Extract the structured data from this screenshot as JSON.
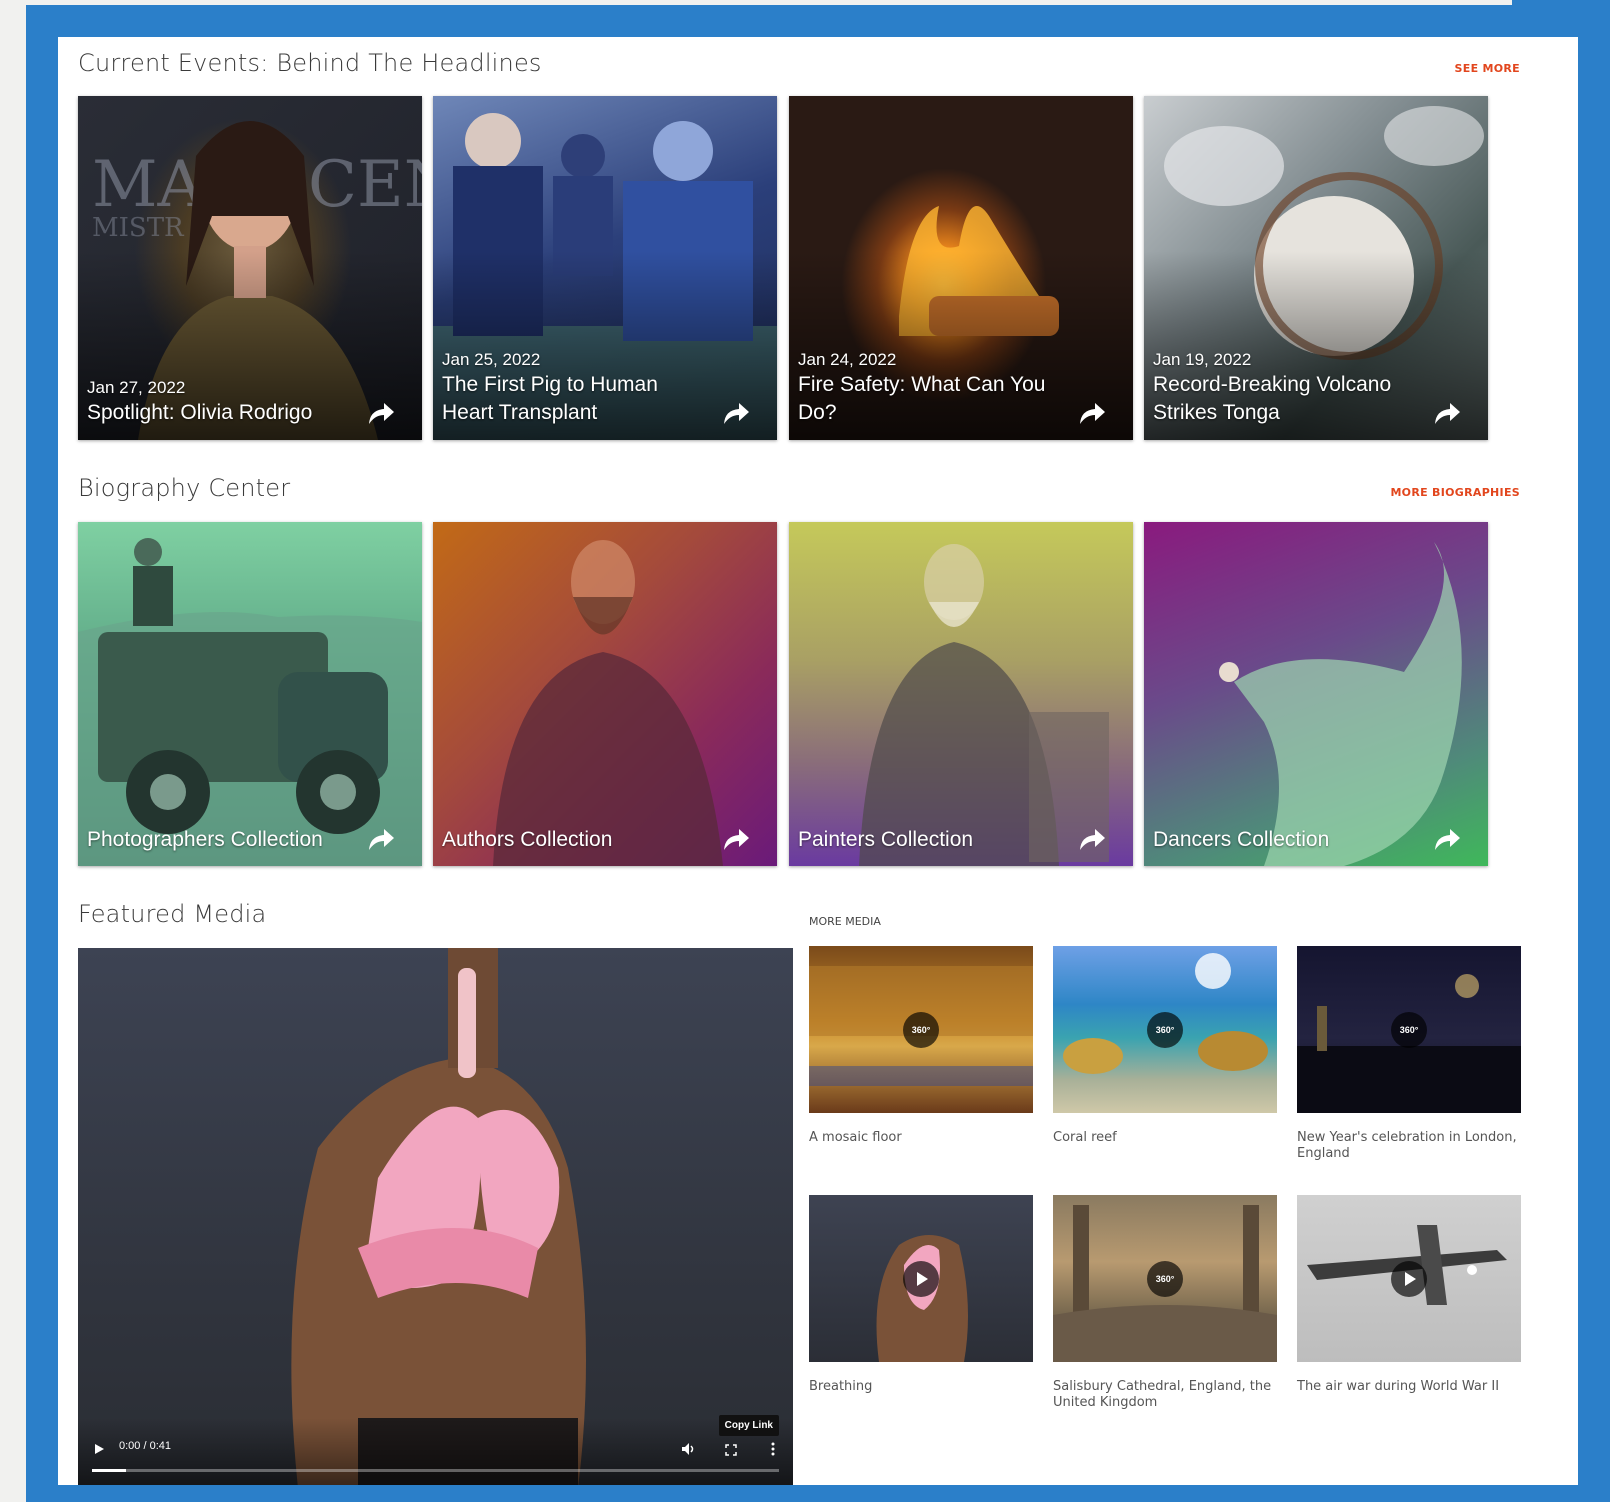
{
  "sections": {
    "current_events": {
      "title": "Current Events: Behind The Headlines",
      "link": "SEE MORE"
    },
    "biography": {
      "title": "Biography Center",
      "link": "MORE BIOGRAPHIES"
    },
    "featured": {
      "title": "Featured Media",
      "more_label": "MORE MEDIA"
    }
  },
  "news": [
    {
      "date": "Jan 27, 2022",
      "title": "Spotlight: Olivia Rodrigo"
    },
    {
      "date": "Jan 25, 2022",
      "title": "The First Pig to Human Heart Transplant"
    },
    {
      "date": "Jan 24, 2022",
      "title": "Fire Safety: What Can You Do?"
    },
    {
      "date": "Jan 19, 2022",
      "title": "Record-Breaking Volcano Strikes Tonga"
    }
  ],
  "biographies": [
    {
      "title": "Photographers Collection"
    },
    {
      "title": "Authors Collection"
    },
    {
      "title": "Painters Collection"
    },
    {
      "title": "Dancers Collection"
    }
  ],
  "video": {
    "timecode": "0:00 / 0:41",
    "copy_link": "Copy Link",
    "progress": 0.05
  },
  "media": [
    {
      "caption": "A mosaic floor",
      "badge": "360°"
    },
    {
      "caption": "Coral reef",
      "badge": "360°"
    },
    {
      "caption": "New Year's celebration in London, England",
      "badge": "360°"
    },
    {
      "caption": "Breathing"
    },
    {
      "caption": "Salisbury Cathedral, England, the United Kingdom",
      "badge": "360°"
    },
    {
      "caption": "The air war during World War II"
    }
  ]
}
